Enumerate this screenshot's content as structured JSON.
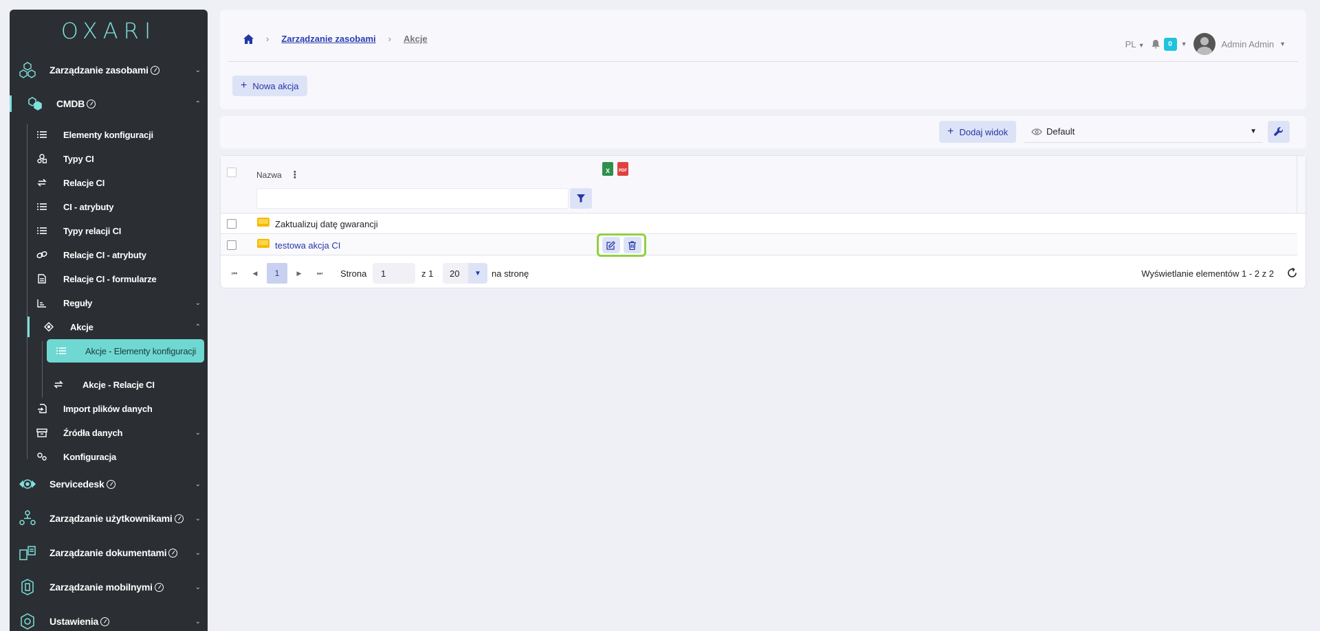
{
  "sidebar": {
    "logo": "OXARI",
    "top_items": [
      {
        "label": "Zarządzanie zasobami",
        "badge": true
      },
      {
        "label": "CMDB",
        "badge": true
      },
      {
        "label": "Servicedesk",
        "badge": true
      },
      {
        "label": "Zarządzanie użytkownikami",
        "badge": true
      },
      {
        "label": "Zarządzanie dokumentami",
        "badge": true
      },
      {
        "label": "Zarządzanie mobilnymi",
        "badge": true
      },
      {
        "label": "Ustawienia",
        "badge": true
      }
    ],
    "cmdb_items": [
      {
        "label": "Elementy konfiguracji"
      },
      {
        "label": "Typy CI"
      },
      {
        "label": "Relacje CI"
      },
      {
        "label": "CI - atrybuty"
      },
      {
        "label": "Typy relacji CI"
      },
      {
        "label": "Relacje CI - atrybuty"
      },
      {
        "label": "Relacje CI - formularze"
      },
      {
        "label": "Reguły"
      },
      {
        "label": "Akcje"
      },
      {
        "label": "Import plików danych"
      },
      {
        "label": "Źródła danych"
      },
      {
        "label": "Konfiguracja"
      }
    ],
    "akcje_items": [
      {
        "label": "Akcje - Elementy konfiguracji"
      },
      {
        "label": "Akcje - Relacje CI"
      }
    ],
    "accent": "#7fe0dc"
  },
  "header": {
    "breadcrumb": [
      "Zarządzanie zasobami",
      "Akcje"
    ],
    "lang": "PL",
    "notifications": "0",
    "user": "Admin Admin",
    "new_action_label": "Nowa akcja"
  },
  "viewbar": {
    "add_view_label": "Dodaj widok",
    "view_selected": "Default"
  },
  "table": {
    "column_name": "Nazwa",
    "export_xls": "X",
    "export_pdf": "PDF",
    "rows": [
      {
        "name": "Zaktualizuj datę gwarancji"
      },
      {
        "name": "testowa akcja CI"
      }
    ]
  },
  "pager": {
    "current_page": "1",
    "page_label": "Strona",
    "page_input": "1",
    "of_label": "z 1",
    "per_page": "20",
    "per_page_label": "na stronę",
    "summary": "Wyświetlanie elementów 1 - 2 z 2"
  }
}
